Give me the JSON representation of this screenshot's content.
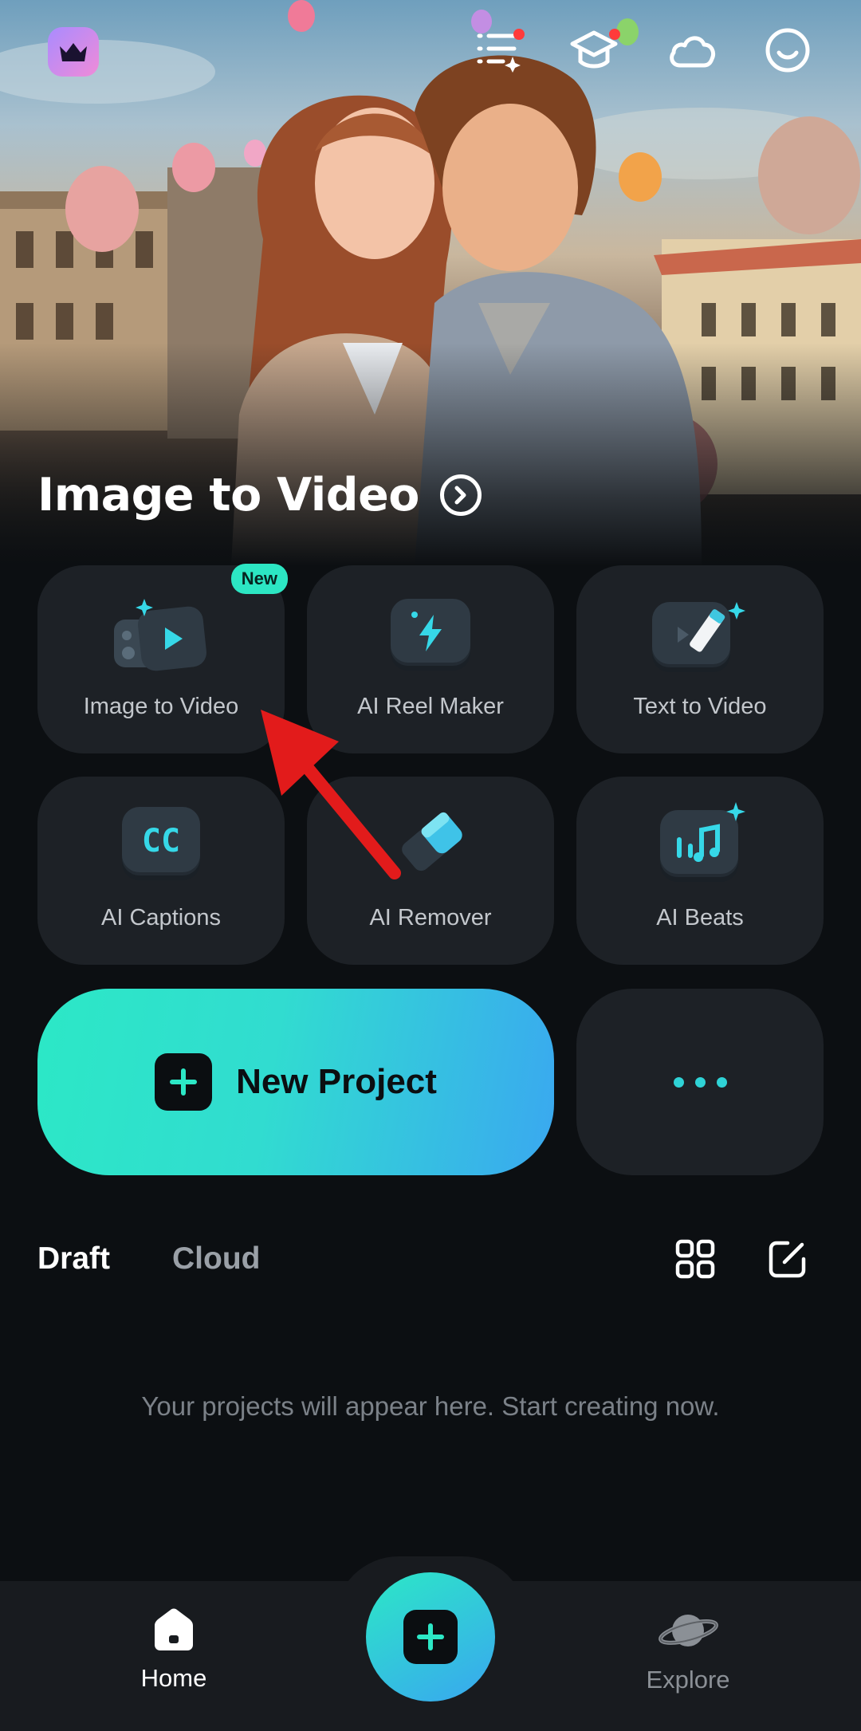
{
  "hero": {
    "title": "Image to Video"
  },
  "tools": [
    {
      "label": "Image to Video",
      "icon": "image-to-video-icon",
      "badge": "New"
    },
    {
      "label": "AI Reel Maker",
      "icon": "lightning-icon"
    },
    {
      "label": "Text to Video",
      "icon": "pencil-sparkle-icon"
    },
    {
      "label": "AI Captions",
      "icon": "cc-icon"
    },
    {
      "label": "AI Remover",
      "icon": "eraser-icon"
    },
    {
      "label": "AI Beats",
      "icon": "music-beats-icon"
    }
  ],
  "new_project": {
    "label": "New Project"
  },
  "tabs": {
    "draft": "Draft",
    "cloud": "Cloud"
  },
  "empty_state": "Your projects will appear here. Start creating now.",
  "bottom_nav": {
    "home": "Home",
    "explore": "Explore"
  },
  "colors": {
    "accent_start": "#2ce8c6",
    "accent_end": "#3aa8f0",
    "badge": "#2ce6c3",
    "arrow": "#e21b1b"
  }
}
